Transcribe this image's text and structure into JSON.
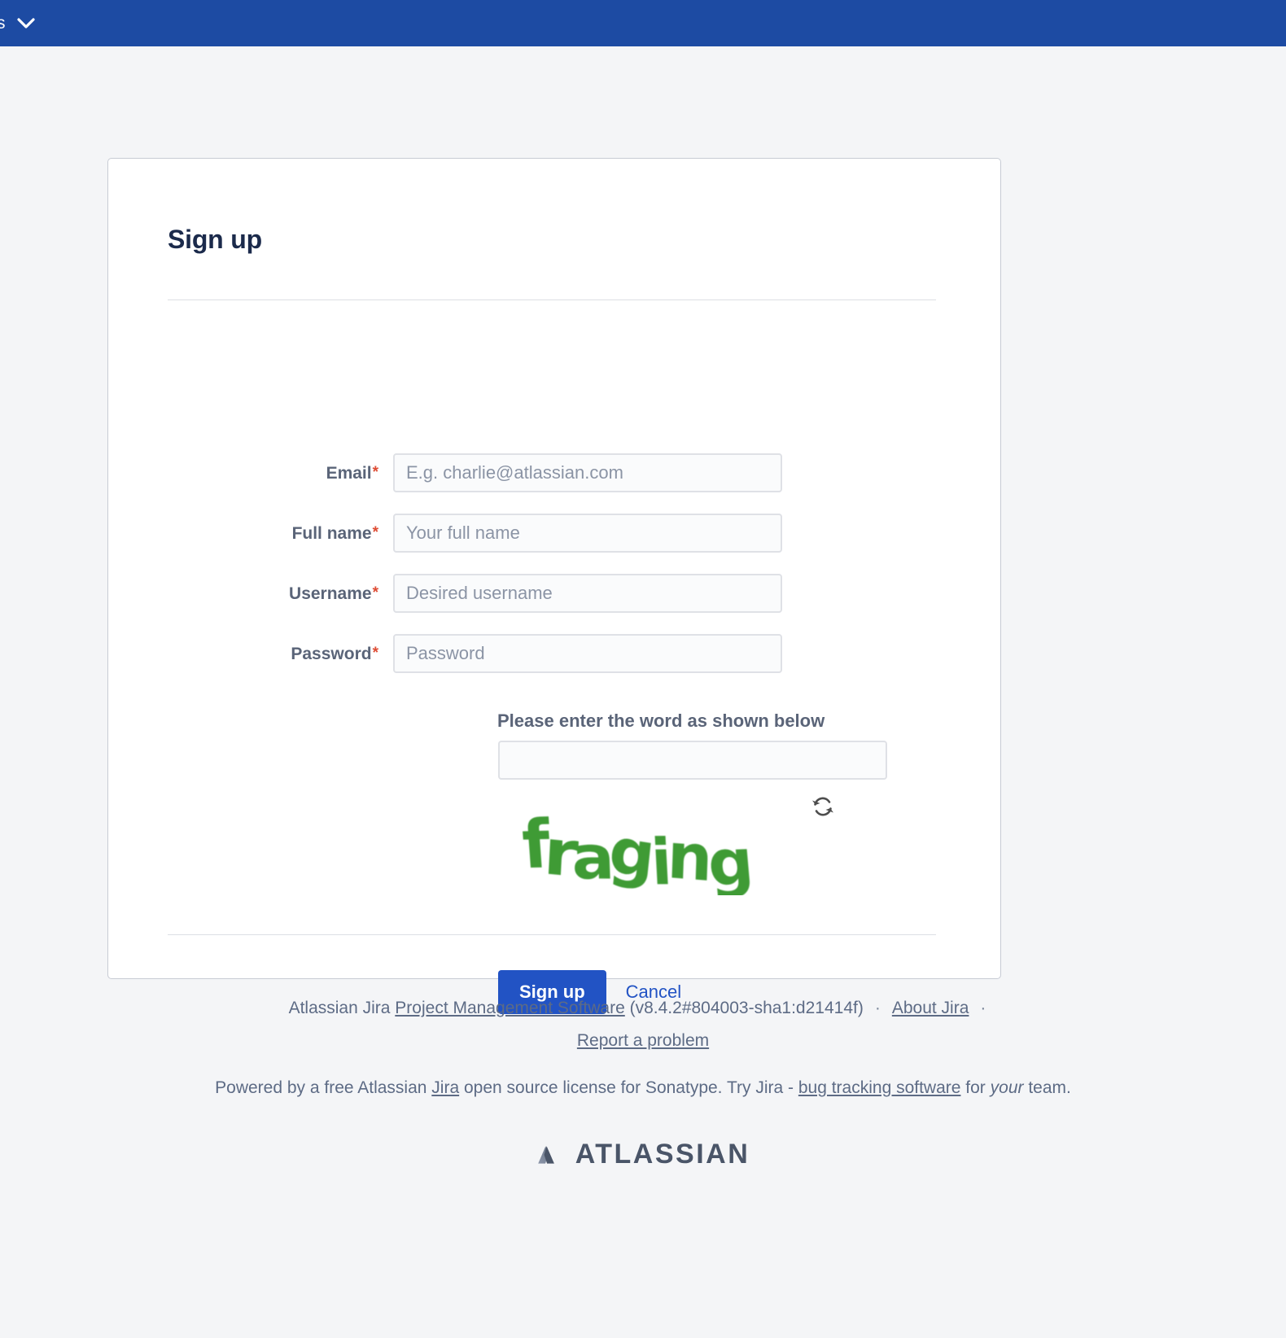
{
  "topnav": {
    "truncated_label": "s",
    "chevron_icon": "chevron-down-icon",
    "background": "#1d4ba3"
  },
  "panel": {
    "title": "Sign up"
  },
  "form": {
    "fields": [
      {
        "label": "Email",
        "required_marker": "*",
        "placeholder": "E.g. charlie@atlassian.com",
        "value": ""
      },
      {
        "label": "Full name",
        "required_marker": "*",
        "placeholder": "Your full name",
        "value": ""
      },
      {
        "label": "Username",
        "required_marker": "*",
        "placeholder": "Desired username",
        "value": ""
      },
      {
        "label": "Password",
        "required_marker": "*",
        "placeholder": "Password",
        "value": ""
      }
    ]
  },
  "captcha": {
    "prompt": "Please enter the word as shown below",
    "input_value": "",
    "input_placeholder": "",
    "word": "fraging",
    "word_color": "#3f9b35",
    "refresh_icon": "refresh-icon"
  },
  "actions": {
    "submit_label": "Sign up",
    "cancel_label": "Cancel",
    "submit_color": "#2253c4"
  },
  "footer": {
    "product_prefix": "Atlassian Jira ",
    "product_link": "Project Management Software",
    "version": " (v8.4.2#804003-sha1:d21414f)",
    "dot": "·",
    "about_link": "About Jira",
    "report_link": "Report a problem",
    "license_prefix": "Powered by a free Atlassian ",
    "license_jira_link": "Jira",
    "license_middle": " open source license for Sonatype. Try Jira - ",
    "license_bug_link": "bug tracking software",
    "license_suffix": " for ",
    "license_your": "your",
    "license_team": " team.",
    "brand_wordmark": "ATLASSIAN",
    "brand_mark_icon": "atlassian-logo-icon"
  }
}
